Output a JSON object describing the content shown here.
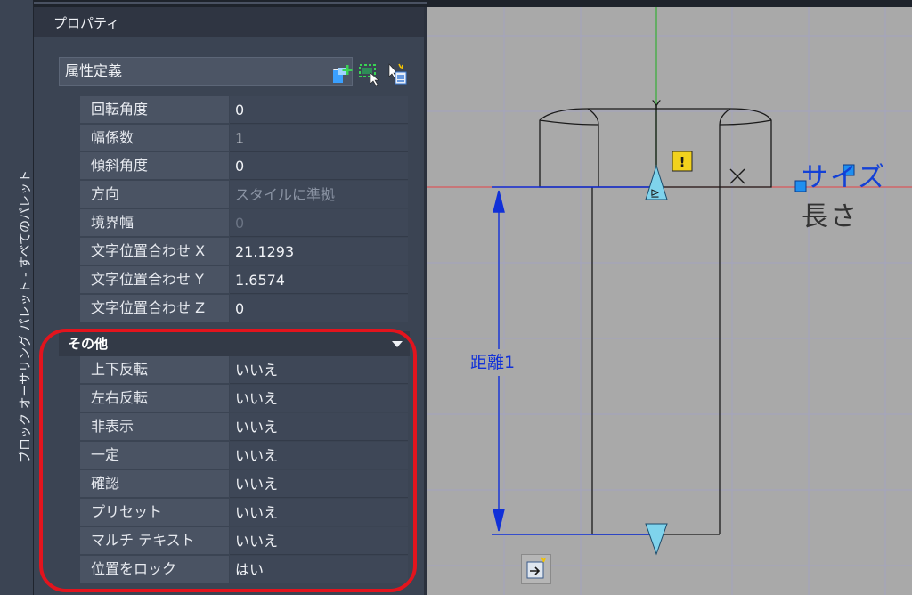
{
  "side_palette": {
    "title": "ブロック オーサリング パレット - すべてのパレット"
  },
  "panel": {
    "title": "プロパティ",
    "dropdown_value": "属性定義",
    "toolbar_icons": [
      "quick-select-icon",
      "select-objects-icon",
      "toggle-pickadd-icon"
    ]
  },
  "text_props": [
    {
      "label": "回転角度",
      "value": "0",
      "style": "normal"
    },
    {
      "label": "幅係数",
      "value": "1",
      "style": "normal"
    },
    {
      "label": "傾斜角度",
      "value": "0",
      "style": "normal"
    },
    {
      "label": "方向",
      "value": "スタイルに準拠",
      "style": "dim"
    },
    {
      "label": "境界幅",
      "value": "0",
      "style": "faint"
    },
    {
      "label": "文字位置合わせ X",
      "value": "21.1293",
      "style": "normal"
    },
    {
      "label": "文字位置合わせ Y",
      "value": "1.6574",
      "style": "normal"
    },
    {
      "label": "文字位置合わせ Z",
      "value": "0",
      "style": "normal"
    }
  ],
  "misc": {
    "header": "その他",
    "rows": [
      {
        "label": "上下反転",
        "value": "いいえ"
      },
      {
        "label": "左右反転",
        "value": "いいえ"
      },
      {
        "label": "非表示",
        "value": "いいえ"
      },
      {
        "label": "一定",
        "value": "いいえ"
      },
      {
        "label": "確認",
        "value": "いいえ"
      },
      {
        "label": "プリセット",
        "value": "いいえ"
      },
      {
        "label": "マルチ テキスト",
        "value": "いいえ"
      },
      {
        "label": "位置をロック",
        "value": "はい"
      }
    ]
  },
  "canvas": {
    "size_label": "サイズ",
    "length_label": "長さ",
    "distance_label": "距離1",
    "axis_label": "Y",
    "warning_mark": "!"
  },
  "colors": {
    "highlight": "#e3141d",
    "parameter_blue": "#1340d6",
    "grip_cyan": "#7fd3ec"
  }
}
